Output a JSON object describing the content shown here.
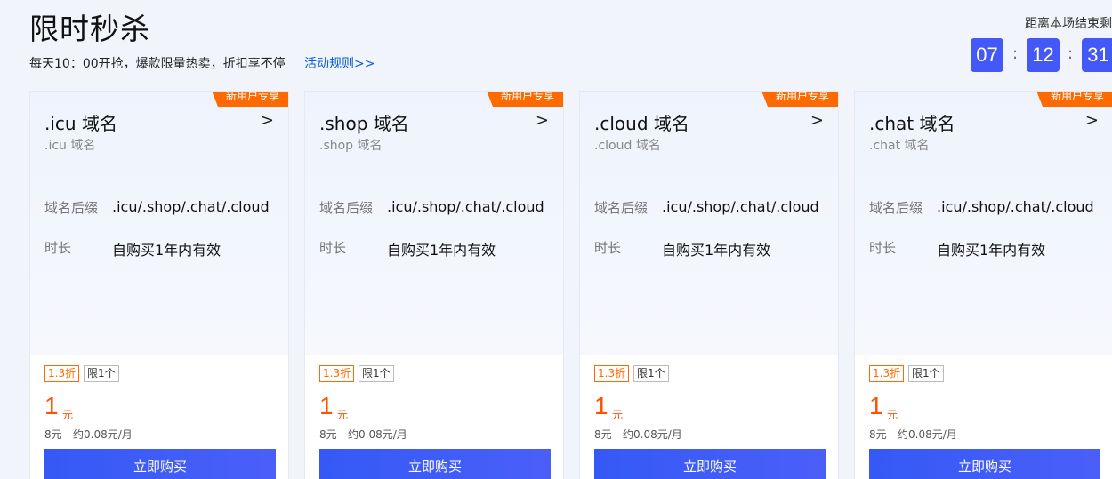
{
  "header": {
    "title": "限时秒杀",
    "subtitle": "每天10：00开抢，爆款限量热卖，折扣享不停",
    "rules_link": "活动规则>>"
  },
  "countdown": {
    "label": "距离本场结束剩",
    "hours": "07",
    "minutes": "12",
    "seconds": "31",
    "separator": ":"
  },
  "colors": {
    "accent": "#4458f7",
    "price": "#ff5000",
    "badge": "#ff6a00",
    "link": "#0b5bd3"
  },
  "cards": [
    {
      "badge": "新用户专享",
      "title": ".icu 域名",
      "subtitle": ".icu 域名",
      "chevron": ">",
      "suffix_label": "域名后缀",
      "suffix_value": ".icu/.shop/.chat/.cloud",
      "duration_label": "时长",
      "duration_value": "自购买1年内有效",
      "discount": "1.3折",
      "limit": "限1个",
      "price": "1",
      "price_unit": "元",
      "original_price": "8元",
      "monthly": "约0.08元/月",
      "buy_label": "立即购买"
    },
    {
      "badge": "新用户专享",
      "title": ".shop 域名",
      "subtitle": ".shop 域名",
      "chevron": ">",
      "suffix_label": "域名后缀",
      "suffix_value": ".icu/.shop/.chat/.cloud",
      "duration_label": "时长",
      "duration_value": "自购买1年内有效",
      "discount": "1.3折",
      "limit": "限1个",
      "price": "1",
      "price_unit": "元",
      "original_price": "8元",
      "monthly": "约0.08元/月",
      "buy_label": "立即购买"
    },
    {
      "badge": "新用户专享",
      "title": ".cloud 域名",
      "subtitle": ".cloud 域名",
      "chevron": ">",
      "suffix_label": "域名后缀",
      "suffix_value": ".icu/.shop/.chat/.cloud",
      "duration_label": "时长",
      "duration_value": "自购买1年内有效",
      "discount": "1.3折",
      "limit": "限1个",
      "price": "1",
      "price_unit": "元",
      "original_price": "8元",
      "monthly": "约0.08元/月",
      "buy_label": "立即购买"
    },
    {
      "badge": "新用户专享",
      "title": ".chat 域名",
      "subtitle": ".chat 域名",
      "chevron": ">",
      "suffix_label": "域名后缀",
      "suffix_value": ".icu/.shop/.chat/.cloud",
      "duration_label": "时长",
      "duration_value": "自购买1年内有效",
      "discount": "1.3折",
      "limit": "限1个",
      "price": "1",
      "price_unit": "元",
      "original_price": "8元",
      "monthly": "约0.08元/月",
      "buy_label": "立即购买"
    }
  ]
}
